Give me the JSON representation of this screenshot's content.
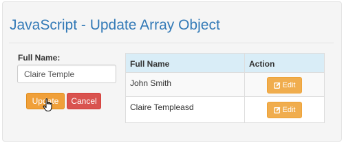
{
  "header": {
    "title": "JavaScript - Update Array Object"
  },
  "form": {
    "label": "Full Name:",
    "input_value": "Claire Temple",
    "update_label": "Update",
    "cancel_label": "Cancel"
  },
  "table": {
    "columns": [
      "Full Name",
      "Action"
    ],
    "rows": [
      {
        "name": "John Smith",
        "action_label": "Edit"
      },
      {
        "name": "Claire Templeasd",
        "action_label": "Edit"
      }
    ]
  },
  "icons": {
    "edit": "edit-icon",
    "cursor": "hand-pointer-icon"
  },
  "colors": {
    "title": "#337ab7",
    "update_button": "#f0a03a",
    "cancel_button": "#d9534f",
    "edit_button": "#f0ad4e",
    "table_header": "#d9edf7"
  }
}
